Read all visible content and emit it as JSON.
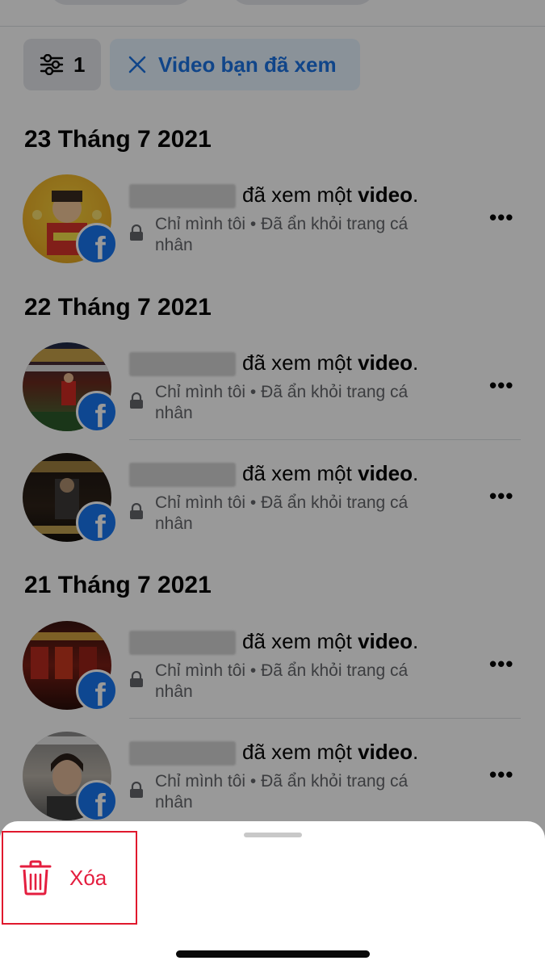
{
  "filters": {
    "count": "1",
    "active_filter": "Video bạn đã xem"
  },
  "groups": [
    {
      "date": "23 Tháng 7 2021",
      "entries": [
        {
          "action_text": "đã xem một",
          "action_bold": "video",
          "action_end": ".",
          "privacy": "Chỉ mình tôi",
          "separator": "•",
          "status": "Đã ẩn khỏi trang cá",
          "status_cont": "nhân",
          "more": "•••"
        }
      ]
    },
    {
      "date": "22 Tháng 7 2021",
      "entries": [
        {
          "action_text": "đã xem một",
          "action_bold": "video",
          "action_end": ".",
          "privacy": "Chỉ mình tôi",
          "separator": "•",
          "status": "Đã ẩn khỏi trang cá",
          "status_cont": "nhân",
          "more": "•••"
        },
        {
          "action_text": "đã xem một",
          "action_bold": "video",
          "action_end": ".",
          "privacy": "Chỉ mình tôi",
          "separator": "•",
          "status": "Đã ẩn khỏi trang cá",
          "status_cont": "nhân",
          "more": "•••"
        }
      ]
    },
    {
      "date": "21 Tháng 7 2021",
      "entries": [
        {
          "action_text": "đã xem một",
          "action_bold": "video",
          "action_end": ".",
          "privacy": "Chỉ mình tôi",
          "separator": "•",
          "status": "Đã ẩn khỏi trang cá",
          "status_cont": "nhân",
          "more": "•••"
        },
        {
          "action_text": "đã xem một",
          "action_bold": "video",
          "action_end": ".",
          "privacy": "Chỉ mình tôi",
          "separator": "•",
          "status": "Đã ẩn khỏi trang cá",
          "status_cont": "nhân",
          "more": "•••"
        }
      ]
    }
  ],
  "badge_letter": "f",
  "sheet": {
    "delete_label": "Xóa"
  },
  "colors": {
    "facebook_blue": "#1877f2",
    "filter_chip_text": "#1b74e4",
    "delete_red": "#e41e3f",
    "highlight_border": "#e0192d"
  },
  "icons": {
    "filter": "sliders-icon",
    "clear": "close-icon",
    "privacy": "lock-icon",
    "more": "more-dots-icon",
    "delete": "trash-icon",
    "source": "facebook-logo-icon"
  }
}
